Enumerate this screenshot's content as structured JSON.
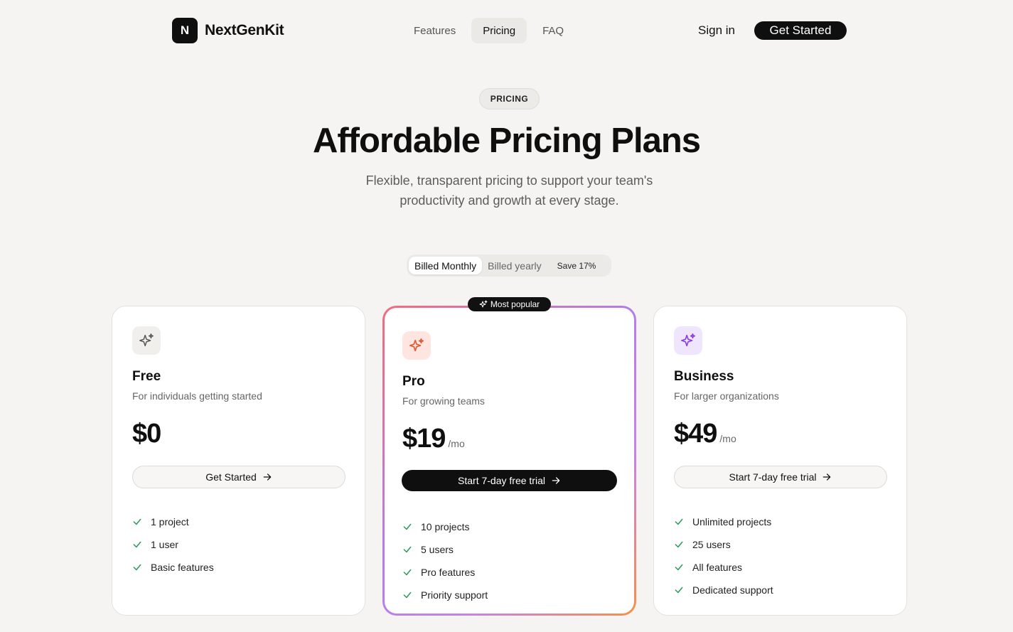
{
  "brand": {
    "mark": "N",
    "name": "NextGenKit"
  },
  "nav": {
    "items": [
      "Features",
      "Pricing",
      "FAQ"
    ],
    "active": "Pricing"
  },
  "header": {
    "signin_label": "Sign in",
    "cta_label": "Get Started"
  },
  "hero": {
    "badge": "PRICING",
    "title": "Affordable Pricing Plans",
    "subtitle": "Flexible, transparent pricing to support your team's productivity and growth at every stage."
  },
  "billing": {
    "monthly_label": "Billed Monthly",
    "yearly_label": "Billed yearly",
    "save_label": "Save 17%",
    "selected": "monthly"
  },
  "popular_badge": "Most popular",
  "colors": {
    "check": "#2e9a57",
    "pro_icon": "#e4572e",
    "business_icon": "#8b3fe0",
    "free_icon": "#555555"
  },
  "plans": [
    {
      "name": "Free",
      "description": "For individuals getting started",
      "price": "$0",
      "period": "",
      "button_label": "Get Started",
      "features": [
        "1 project",
        "1 user",
        "Basic features"
      ]
    },
    {
      "name": "Pro",
      "description": "For growing teams",
      "price": "$19",
      "period": "/mo",
      "button_label": "Start 7-day free trial",
      "features": [
        "10 projects",
        "5 users",
        "Pro features",
        "Priority support"
      ]
    },
    {
      "name": "Business",
      "description": "For larger organizations",
      "price": "$49",
      "period": "/mo",
      "button_label": "Start 7-day free trial",
      "features": [
        "Unlimited projects",
        "25 users",
        "All features",
        "Dedicated support"
      ]
    }
  ]
}
